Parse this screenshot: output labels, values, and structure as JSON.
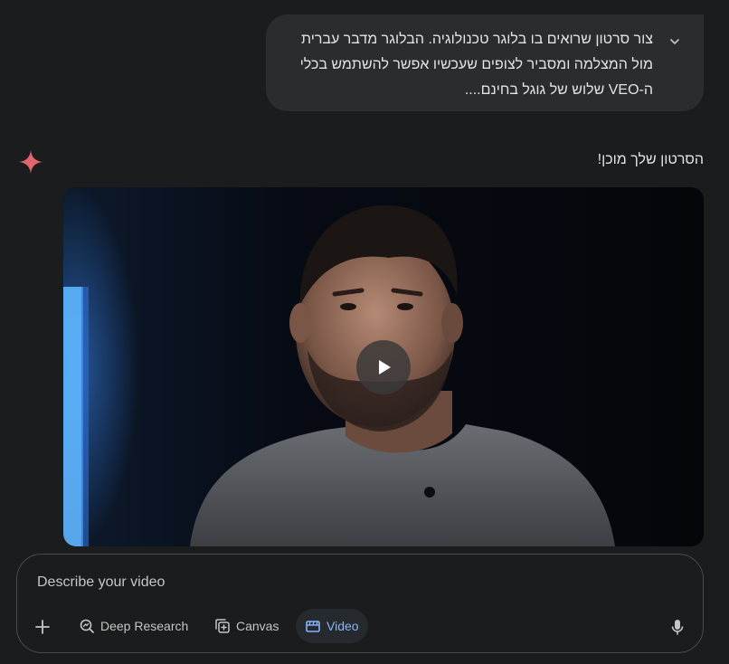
{
  "user_message": {
    "lines": [
      "צור סרטון שרואים בו בלוגר טכנולוגיה. הבלוגר מדבר עברית",
      "מול המצלמה ומסביר לצופים שעכשיו אפשר להשתמש בכלי",
      "ה-VEO שלוש של גוגל בחינם...."
    ]
  },
  "response": {
    "text": "הסרטון שלך מוכן!"
  },
  "composer": {
    "placeholder": "Describe your video",
    "tools": {
      "deep_research": "Deep Research",
      "canvas": "Canvas",
      "video": "Video"
    }
  },
  "colors": {
    "background": "#1b1c1d",
    "bubble": "#2b2c2e",
    "accent_blue": "#8ab4f8",
    "spark": "#e0656d"
  }
}
